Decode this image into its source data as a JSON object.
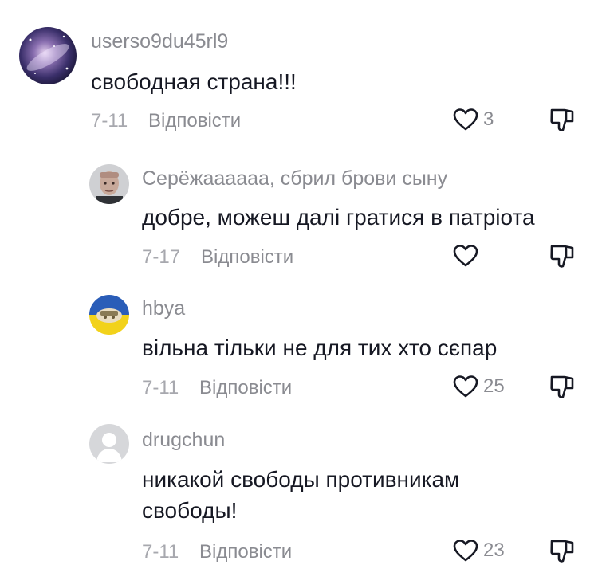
{
  "comments": [
    {
      "username": "userso9du45rl9",
      "text": "свободная страна!!!",
      "date": "7-11",
      "reply_label": "Відповісти",
      "likes": "3",
      "avatar_icon": "galaxy-avatar"
    },
    {
      "username": "Серёжаааааа, сбрил брови сыну",
      "text": "добре, можеш далі гратися в патріота",
      "date": "7-17",
      "reply_label": "Відповісти",
      "likes": "",
      "avatar_icon": "face-avatar"
    },
    {
      "username": "hbya",
      "text": "вільна тільки не для тих хто сєпар",
      "date": "7-11",
      "reply_label": "Відповісти",
      "likes": "25",
      "avatar_icon": "ukraine-flag-avatar"
    },
    {
      "username": "drugchun",
      "text_line1": "никакой свободы противникам",
      "text_line2": "свободы!",
      "date": "7-11",
      "reply_label": "Відповісти",
      "likes": "23",
      "avatar_icon": "default-person-avatar"
    }
  ],
  "colors": {
    "username": "#8a8b91",
    "text": "#161823",
    "meta": "#a7a8ae",
    "icon": "#161823"
  }
}
